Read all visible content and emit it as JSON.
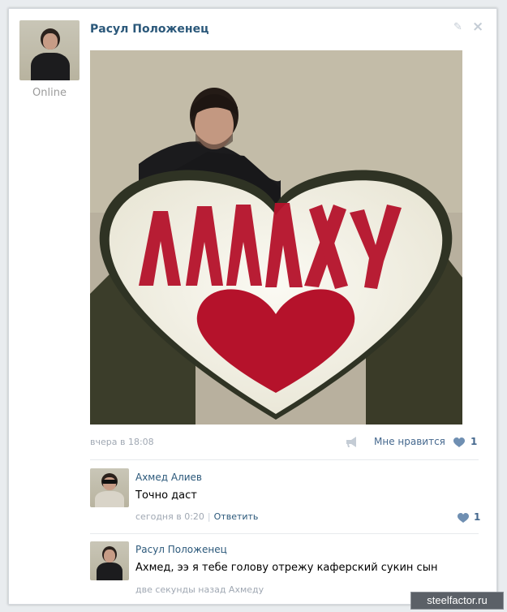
{
  "post": {
    "author_name": "Расул Положенец",
    "status": "Online",
    "time": "вчера в 18:08",
    "like_label": "Мне нравится",
    "like_count": "1",
    "photo_text": "АЛЛАХУ"
  },
  "comments": [
    {
      "author": "Ахмед Алиев",
      "text": "Точно даст",
      "time": "сегодня в 0:20",
      "separator": "|",
      "reply_label": "Ответить",
      "like_count": "1"
    },
    {
      "author": "Расул Положенец",
      "text": "Ахмед, ээ я тебе голову отрежу каферский сукин сын",
      "time": "две секунды назад Ахмеду"
    }
  ],
  "watermark": "steelfactor.ru",
  "icons": [
    "pencil-icon",
    "close-icon",
    "share-icon",
    "heart-icon"
  ],
  "colors": {
    "link": "#2b587a",
    "meta": "#a0a8b3",
    "heart": "#6f8fb2",
    "roses": "#b5122b"
  }
}
